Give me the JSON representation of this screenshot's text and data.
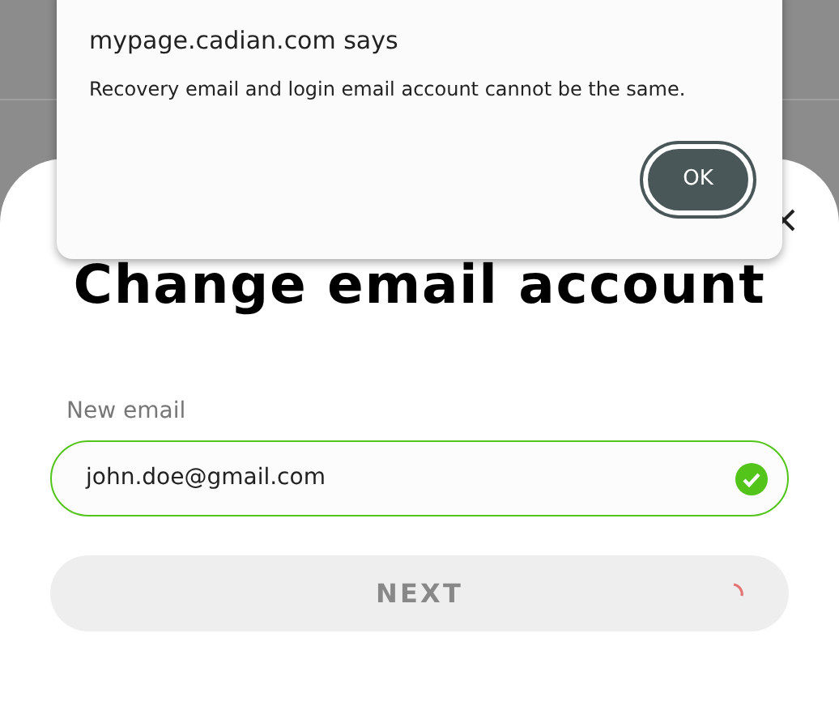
{
  "dialog": {
    "title": "mypage.cadian.com says",
    "message": "Recovery email and login email account cannot be the same.",
    "button": "OK"
  },
  "sheet": {
    "title": "Change email account",
    "field": {
      "label": "New email",
      "value": "john.doe@gmail.com",
      "valid": true
    },
    "next_button": {
      "label": "NEXT",
      "disabled": true,
      "loading": true
    }
  }
}
